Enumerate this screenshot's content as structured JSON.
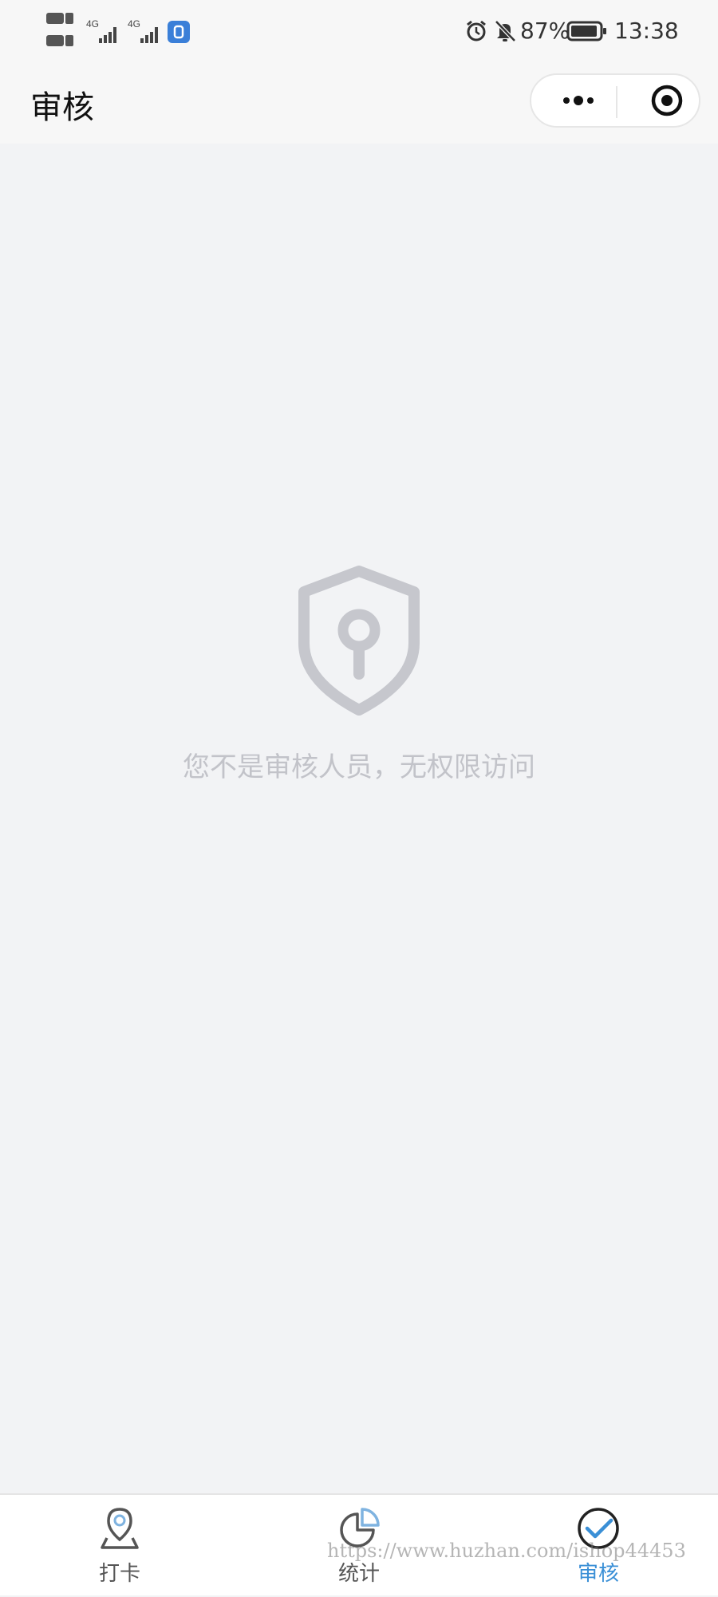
{
  "status_bar": {
    "hd1": "HD1",
    "hd2": "HD2",
    "net1": "4G",
    "net2": "4G",
    "battery_percent": "87%",
    "time": "13:38"
  },
  "nav": {
    "title": "审核"
  },
  "empty_state": {
    "message": "您不是审核人员，无权限访问",
    "icon": "shield-keyhole-icon"
  },
  "tabbar": {
    "items": [
      {
        "label": "打卡",
        "icon": "location-pin-icon",
        "active": false
      },
      {
        "label": "统计",
        "icon": "pie-chart-icon",
        "active": false
      },
      {
        "label": "审核",
        "icon": "check-circle-icon",
        "active": true
      }
    ]
  },
  "watermark": "https://www.huzhan.com/ishop44453",
  "colors": {
    "accent": "#3a8fd6",
    "muted_text": "#c2c3c9",
    "shield": "#c6c7cd",
    "background": "#f2f3f5"
  }
}
